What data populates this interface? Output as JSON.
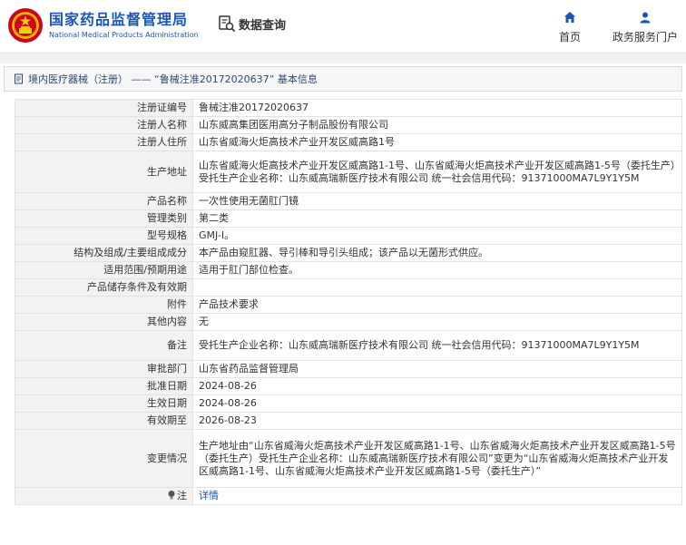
{
  "header": {
    "logo_cn": "国家药品监督管理局",
    "logo_en": "National Medical Products Administration",
    "query_label": "数据查询",
    "nav": [
      {
        "label": "首页",
        "icon": "home-icon"
      },
      {
        "label": "政务服务门户",
        "icon": "user-icon"
      }
    ]
  },
  "title": "境内医疗器械（注册） —— “鲁械注准20172020637” 基本信息",
  "rows": [
    {
      "label": "注册证编号",
      "value": "鲁械注准20172020637"
    },
    {
      "label": "注册人名称",
      "value": "山东威高集团医用高分子制品股份有限公司"
    },
    {
      "label": "注册人住所",
      "value": "山东省威海火炬高技术产业开发区威高路1号"
    },
    {
      "label": "生产地址",
      "value": "山东省威海火炬高技术产业开发区威高路1-1号、山东省威海火炬高技术产业开发区威高路1-5号（委托生产）受托生产企业名称：山东威高瑞新医疗技术有限公司 统一社会信用代码：91371000MA7L9Y1Y5M"
    },
    {
      "label": "产品名称",
      "value": "一次性使用无菌肛门镜"
    },
    {
      "label": "管理类别",
      "value": "第二类"
    },
    {
      "label": "型号规格",
      "value": "GMJ-Ⅰ。"
    },
    {
      "label": "结构及组成/主要组成成分",
      "value": "本产品由窥肛器、导引棒和导引头组成；该产品以无菌形式供应。"
    },
    {
      "label": "适用范围/预期用途",
      "value": "适用于肛门部位检查。"
    },
    {
      "label": "产品储存条件及有效期",
      "value": ""
    },
    {
      "label": "附件",
      "value": "产品技术要求"
    },
    {
      "label": "其他内容",
      "value": "无"
    },
    {
      "label": "备注",
      "value": "受托生产企业名称：山东威高瑞新医疗技术有限公司 统一社会信用代码：91371000MA7L9Y1Y5M"
    },
    {
      "label": "审批部门",
      "value": "山东省药品监督管理局"
    },
    {
      "label": "批准日期",
      "value": "2024-08-26"
    },
    {
      "label": "生效日期",
      "value": "2024-08-26"
    },
    {
      "label": "有效期至",
      "value": "2026-08-23"
    },
    {
      "label": "变更情况",
      "value": "生产地址由“山东省威海火炬高技术产业开发区威高路1-1号、山东省威海火炬高技术产业开发区威高路1-5号（委托生产）受托生产企业名称：山东威高瑞新医疗技术有限公司”变更为“山东省威海火炬高技术产业开发区威高路1-1号、山东省威海火炬高技术产业开发区威高路1-5号（委托生产）”"
    }
  ],
  "note": {
    "label": "注",
    "link": "详情",
    "icon": "lightbulb-icon"
  },
  "colors": {
    "brand": "#1a56b6",
    "label_bg": "#f2f2f2",
    "emblem_red": "#d0021b"
  }
}
